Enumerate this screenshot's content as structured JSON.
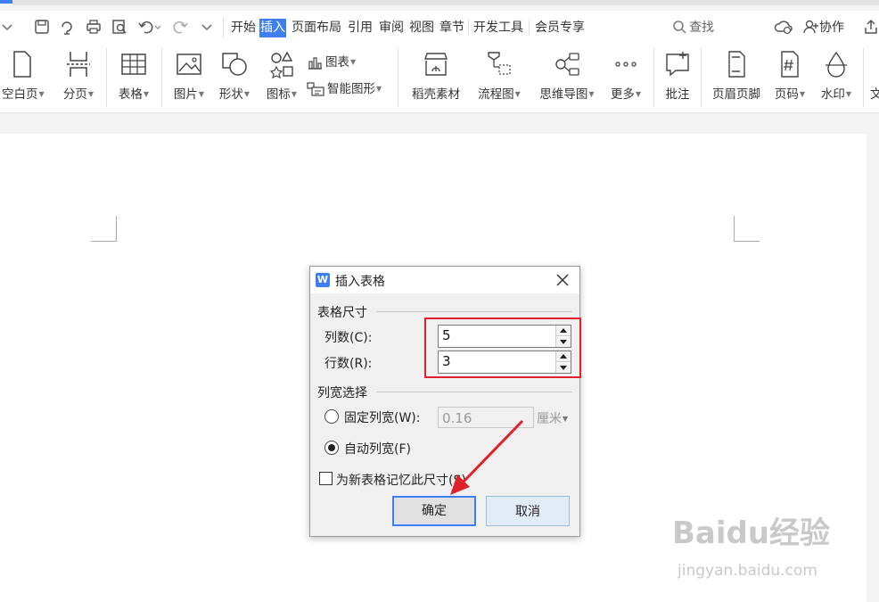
{
  "menubar": {
    "tabs": [
      "开始",
      "插入",
      "页面布局",
      "引用",
      "审阅",
      "视图",
      "章节",
      "开发工具",
      "会员专享"
    ],
    "active_tab": "插入",
    "search_label": "查找",
    "collab_label": "协作"
  },
  "ribbon": {
    "blank_page": "空白页",
    "page_break": "分页",
    "table": "表格",
    "picture": "图片",
    "shape": "形状",
    "icon": "图标",
    "chart": "图表",
    "smart_art": "智能图形",
    "materials": "稻壳素材",
    "flowchart": "流程图",
    "mindmap": "思维导图",
    "more": "更多",
    "comment": "批注",
    "header_footer": "页眉页脚",
    "page_number": "页码",
    "watermark": "水印",
    "cut_off_item": "文"
  },
  "dialog": {
    "title": "插入表格",
    "size_group": "表格尺寸",
    "columns_label": "列数(C):",
    "columns_value": "5",
    "rows_label": "行数(R):",
    "rows_value": "3",
    "width_group": "列宽选择",
    "fixed_width_label": "固定列宽(W):",
    "fixed_width_value": "0.16",
    "fixed_width_unit": "厘米",
    "auto_width_label": "自动列宽(F)",
    "remember_label": "为新表格记忆此尺寸(S)",
    "ok_label": "确定",
    "cancel_label": "取消"
  },
  "watermark": {
    "brand": "Baidu经验",
    "url": "jingyan.baidu.com"
  },
  "colors": {
    "accent": "#3d7ff0",
    "annotation_red": "#e0202b"
  }
}
